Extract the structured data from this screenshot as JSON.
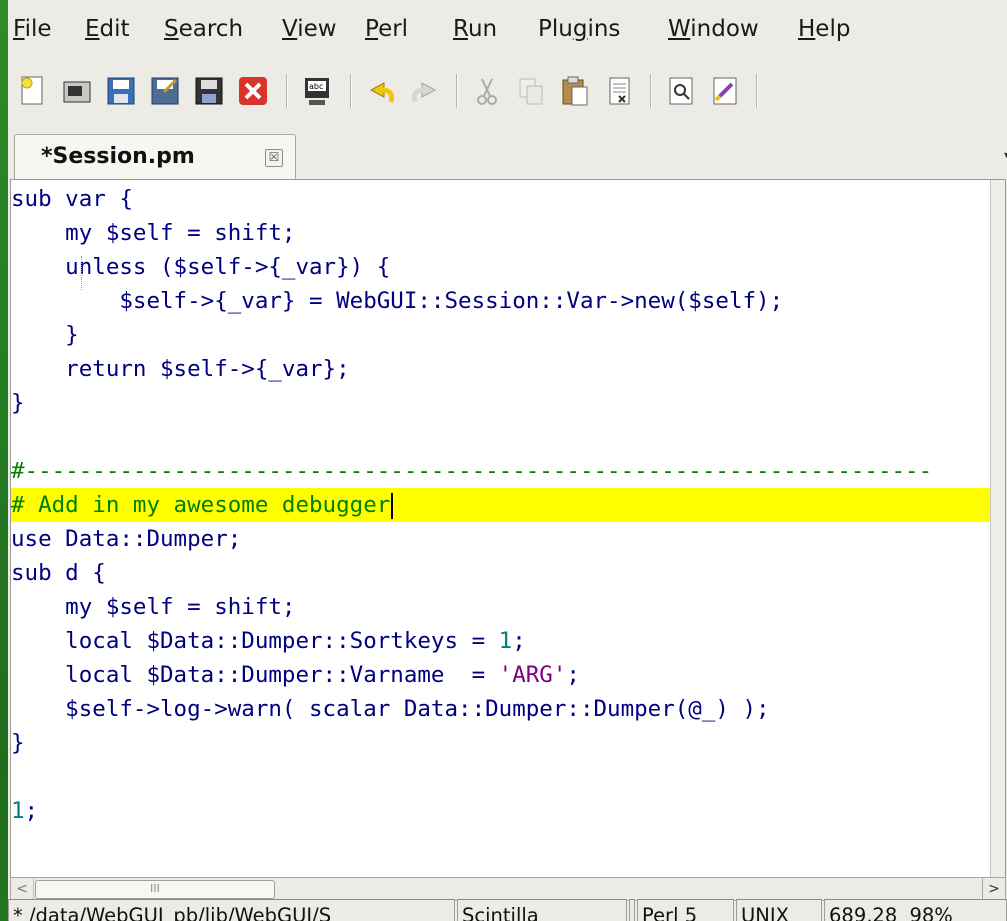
{
  "menu": [
    "File",
    "Edit",
    "Search",
    "View",
    "Perl",
    "Run",
    "Plugins",
    "Window",
    "Help"
  ],
  "menu_mnemonics": [
    "F",
    "E",
    "S",
    "V",
    "P",
    "R",
    "g",
    "W",
    "H"
  ],
  "toolbar": [
    "new-file-icon",
    "open-file-icon",
    "save-icon",
    "save-as-icon",
    "save-all-icon",
    "close-file-icon",
    "spellcheck-icon",
    "undo-icon",
    "redo-icon",
    "cut-icon",
    "copy-icon",
    "paste-icon",
    "select-all-icon",
    "find-icon",
    "replace-icon"
  ],
  "tab": {
    "label": "*Session.pm",
    "close_glyph": "☒",
    "menu_glyph": "▾"
  },
  "code": [
    {
      "t": "sub var {"
    },
    {
      "t": "    my $self = shift;"
    },
    {
      "t": "    unless ($self->{_var}) {"
    },
    {
      "t": "        $self->{_var} = WebGUI::Session::Var->new($self);"
    },
    {
      "t": "    }"
    },
    {
      "t": "    return $self->{_var};"
    },
    {
      "t": "}"
    },
    {
      "t": ""
    },
    {
      "t": "#-------------------------------------------------------------------",
      "cls": "cm"
    },
    {
      "t": "# Add in my awesome debugger",
      "cls": "cm",
      "highlight": true,
      "caret": true
    },
    {
      "t": "use Data::Dumper;"
    },
    {
      "t": "sub d {"
    },
    {
      "t": "    my $self = shift;"
    },
    {
      "t": "    local $Data::Dumper::Sortkeys = 1;"
    },
    {
      "t": "    local $Data::Dumper::Varname  = 'ARG';"
    },
    {
      "t": "    $self->log->warn( scalar Data::Dumper::Dumper(@_) );"
    },
    {
      "t": "}"
    },
    {
      "t": ""
    },
    {
      "t": "1;"
    }
  ],
  "hscroll": {
    "thumb_grip": "III",
    "left_arrow": "<",
    "right_arrow": ">"
  },
  "status": {
    "file": "* /data/WebGUI_pb/lib/WebGUI/S",
    "lexer": "Scintilla",
    "blank": "",
    "language": "Perl 5",
    "newline": "UNIX",
    "position": "689,28",
    "percent": "98%"
  },
  "colors": {
    "keyword": "#000080",
    "comment": "#008000",
    "number": "#007f7f",
    "string": "#7f007f",
    "current_line": "#ffff00"
  }
}
